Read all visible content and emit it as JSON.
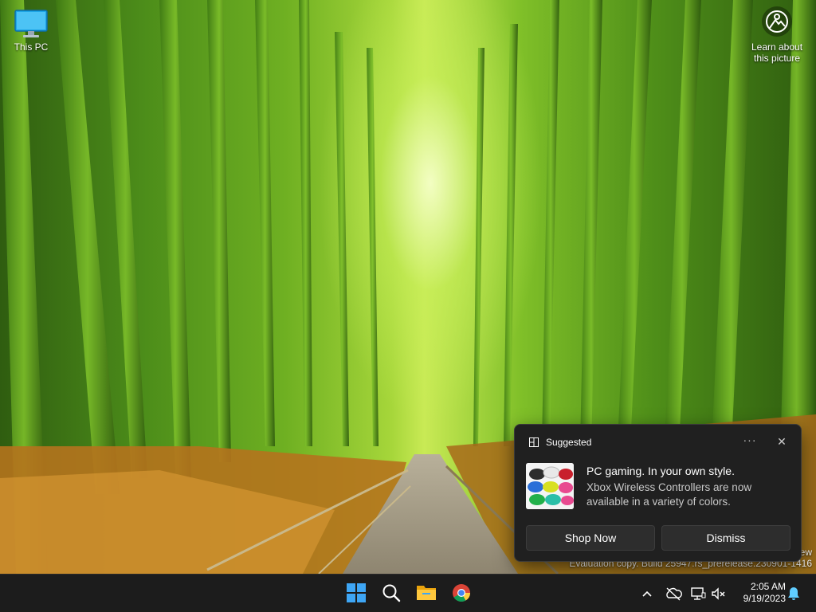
{
  "desktop": {
    "this_pc_label": "This PC",
    "learn_label_line1": "Learn about",
    "learn_label_line2": "this picture"
  },
  "watermark": {
    "partial_line": "ew",
    "build_line": "Evaluation copy. Build 25947.rs_prerelease.230901-1416"
  },
  "notification": {
    "app_name": "Suggested",
    "more_glyph": "···",
    "close_glyph": "✕",
    "title": "PC gaming. In your own style.",
    "body": "Xbox Wireless Controllers are now available in a variety of colors.",
    "primary_button": "Shop Now",
    "secondary_button": "Dismiss"
  },
  "taskbar": {
    "apps": [
      {
        "name": "start",
        "icon": "windows-logo-icon"
      },
      {
        "name": "search",
        "icon": "search-icon"
      },
      {
        "name": "file-explorer",
        "icon": "folder-icon"
      },
      {
        "name": "chrome",
        "icon": "chrome-icon"
      }
    ],
    "tray_icons": [
      "chevron-up-icon",
      "onedrive-offline-icon",
      "network-icon",
      "volume-muted-icon"
    ],
    "time": "2:05 AM",
    "date": "9/19/2023"
  },
  "colors": {
    "accent": "#60cdff",
    "toast_bg": "#202020",
    "taskbar_bg": "#1c1c1c"
  }
}
